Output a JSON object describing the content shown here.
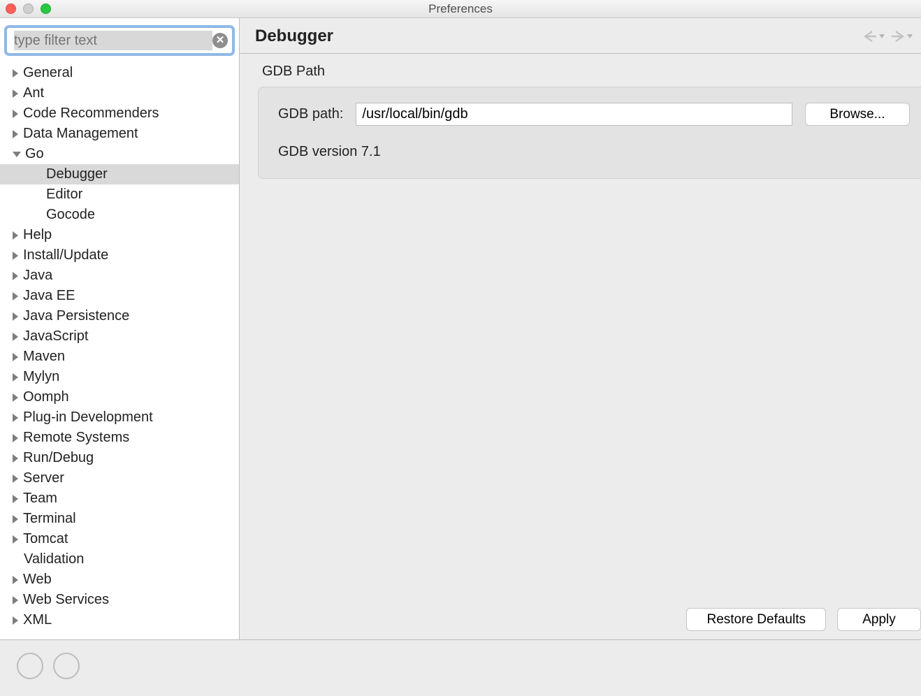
{
  "window": {
    "title": "Preferences"
  },
  "search": {
    "placeholder": "type filter text"
  },
  "tree": {
    "items": [
      {
        "label": "General",
        "expanded": false,
        "level": 0,
        "hasChildren": true
      },
      {
        "label": "Ant",
        "expanded": false,
        "level": 0,
        "hasChildren": true
      },
      {
        "label": "Code Recommenders",
        "expanded": false,
        "level": 0,
        "hasChildren": true
      },
      {
        "label": "Data Management",
        "expanded": false,
        "level": 0,
        "hasChildren": true
      },
      {
        "label": "Go",
        "expanded": true,
        "level": 0,
        "hasChildren": true
      },
      {
        "label": "Debugger",
        "expanded": false,
        "level": 1,
        "hasChildren": false,
        "selected": true
      },
      {
        "label": "Editor",
        "expanded": false,
        "level": 1,
        "hasChildren": false
      },
      {
        "label": "Gocode",
        "expanded": false,
        "level": 1,
        "hasChildren": false
      },
      {
        "label": "Help",
        "expanded": false,
        "level": 0,
        "hasChildren": true
      },
      {
        "label": "Install/Update",
        "expanded": false,
        "level": 0,
        "hasChildren": true
      },
      {
        "label": "Java",
        "expanded": false,
        "level": 0,
        "hasChildren": true
      },
      {
        "label": "Java EE",
        "expanded": false,
        "level": 0,
        "hasChildren": true
      },
      {
        "label": "Java Persistence",
        "expanded": false,
        "level": 0,
        "hasChildren": true
      },
      {
        "label": "JavaScript",
        "expanded": false,
        "level": 0,
        "hasChildren": true
      },
      {
        "label": "Maven",
        "expanded": false,
        "level": 0,
        "hasChildren": true
      },
      {
        "label": "Mylyn",
        "expanded": false,
        "level": 0,
        "hasChildren": true
      },
      {
        "label": "Oomph",
        "expanded": false,
        "level": 0,
        "hasChildren": true
      },
      {
        "label": "Plug-in Development",
        "expanded": false,
        "level": 0,
        "hasChildren": true
      },
      {
        "label": "Remote Systems",
        "expanded": false,
        "level": 0,
        "hasChildren": true
      },
      {
        "label": "Run/Debug",
        "expanded": false,
        "level": 0,
        "hasChildren": true
      },
      {
        "label": "Server",
        "expanded": false,
        "level": 0,
        "hasChildren": true
      },
      {
        "label": "Team",
        "expanded": false,
        "level": 0,
        "hasChildren": true
      },
      {
        "label": "Terminal",
        "expanded": false,
        "level": 0,
        "hasChildren": true
      },
      {
        "label": "Tomcat",
        "expanded": false,
        "level": 0,
        "hasChildren": true
      },
      {
        "label": "Validation",
        "expanded": false,
        "level": 0,
        "hasChildren": false
      },
      {
        "label": "Web",
        "expanded": false,
        "level": 0,
        "hasChildren": true
      },
      {
        "label": "Web Services",
        "expanded": false,
        "level": 0,
        "hasChildren": true
      },
      {
        "label": "XML",
        "expanded": false,
        "level": 0,
        "hasChildren": true
      }
    ]
  },
  "page": {
    "title": "Debugger",
    "group_label": "GDB Path",
    "gdb_path_label": "GDB path:",
    "gdb_path_value": "/usr/local/bin/gdb",
    "browse": "Browse...",
    "version": "GDB version 7.1",
    "restore": "Restore Defaults",
    "apply": "Apply"
  }
}
